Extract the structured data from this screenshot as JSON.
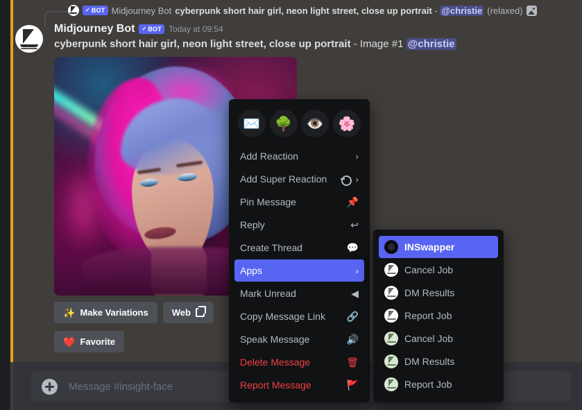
{
  "reply_reference": {
    "avatar_name": "midjourney-bot-avatar",
    "bot_tag": "BOT",
    "bot_tag_check": "✓",
    "author": "Midjourney Bot",
    "content": "cyberpunk short hair girl, neon light street, close up portrait",
    "dash": " - ",
    "mention": "@christie",
    "suffix": "(relaxed)",
    "attachment_icon": "image-icon"
  },
  "message": {
    "author": "Midjourney Bot",
    "bot_tag": "BOT",
    "bot_tag_check": "✓",
    "timestamp": "Today at 09:54",
    "prompt": "cyberpunk short hair girl, neon light street, close up portrait",
    "dash": " - ",
    "image_label": "Image #1",
    "mention": "@christie"
  },
  "attachment": {
    "alt": "cyberpunk short hair girl with pink and blue hair, neon light street, close up portrait"
  },
  "action_buttons": [
    {
      "label": "Make Variations",
      "icon": "magic-wand-icon",
      "glyph": "✨"
    },
    {
      "label": "Web",
      "icon": "external-link-icon",
      "glyph": ""
    },
    {
      "label": "Favorite",
      "icon": "heart-icon",
      "glyph": "❤️"
    }
  ],
  "composer": {
    "placeholder": "Message #insight-face",
    "value": "",
    "add_icon": "plus-circle-icon"
  },
  "context_menu": {
    "quick_reactions": [
      {
        "name": "envelope-emoji",
        "glyph": "✉️"
      },
      {
        "name": "tree-emoji",
        "glyph": "🌳"
      },
      {
        "name": "eye-emoji",
        "glyph": "👁️"
      },
      {
        "name": "cherry-blossom-emoji",
        "glyph": "🌸"
      }
    ],
    "items": [
      {
        "label": "Add Reaction",
        "icon": "chevron-right-icon",
        "glyph": "›",
        "type": "normal",
        "submenu": true,
        "selected": false
      },
      {
        "label": "Add Super Reaction",
        "icon": "super-reaction-icon",
        "glyph": "",
        "type": "normal",
        "submenu": true,
        "selected": false
      },
      {
        "label": "Pin Message",
        "icon": "pin-icon",
        "glyph": "📌",
        "type": "normal",
        "submenu": false,
        "selected": false
      },
      {
        "label": "Reply",
        "icon": "reply-arrow-icon",
        "glyph": "↩",
        "type": "normal",
        "submenu": false,
        "selected": false
      },
      {
        "label": "Create Thread",
        "icon": "thread-icon",
        "glyph": "💬",
        "type": "normal",
        "submenu": false,
        "selected": false
      },
      {
        "label": "Apps",
        "icon": "chevron-right-icon",
        "glyph": "›",
        "type": "normal",
        "submenu": true,
        "selected": true
      },
      {
        "label": "Mark Unread",
        "icon": "mark-unread-icon",
        "glyph": "◀",
        "type": "normal",
        "submenu": false,
        "selected": false
      },
      {
        "label": "Copy Message Link",
        "icon": "link-icon",
        "glyph": "🔗",
        "type": "normal",
        "submenu": false,
        "selected": false
      },
      {
        "label": "Speak Message",
        "icon": "speaker-icon",
        "glyph": "🔊",
        "type": "normal",
        "submenu": false,
        "selected": false
      },
      {
        "label": "Delete Message",
        "icon": "trash-icon",
        "glyph": "🗑",
        "type": "danger",
        "submenu": false,
        "selected": false
      },
      {
        "label": "Report Message",
        "icon": "flag-icon",
        "glyph": "🚩",
        "type": "danger",
        "submenu": false,
        "selected": false
      }
    ]
  },
  "apps_submenu": {
    "items": [
      {
        "label": "INSwapper",
        "icon": "inswapper-app-icon",
        "variant": "dark",
        "selected": true
      },
      {
        "label": "Cancel Job",
        "icon": "midjourney-app-icon",
        "variant": "white",
        "selected": false
      },
      {
        "label": "DM Results",
        "icon": "midjourney-app-icon",
        "variant": "white",
        "selected": false
      },
      {
        "label": "Report Job",
        "icon": "midjourney-app-icon",
        "variant": "white",
        "selected": false
      },
      {
        "label": "Cancel Job",
        "icon": "midjourney-app-icon",
        "variant": "green",
        "selected": false
      },
      {
        "label": "DM Results",
        "icon": "midjourney-app-icon",
        "variant": "green",
        "selected": false
      },
      {
        "label": "Report Job",
        "icon": "midjourney-app-icon",
        "variant": "green",
        "selected": false
      }
    ]
  },
  "colors": {
    "app_background": "#403D3A",
    "menu_background": "#111214",
    "accent": "#5865f2",
    "danger": "#f23f43",
    "unread_bar": "#e8a317",
    "composer_background": "#313338",
    "composer_input": "#383a40",
    "button": "#4e5058"
  }
}
